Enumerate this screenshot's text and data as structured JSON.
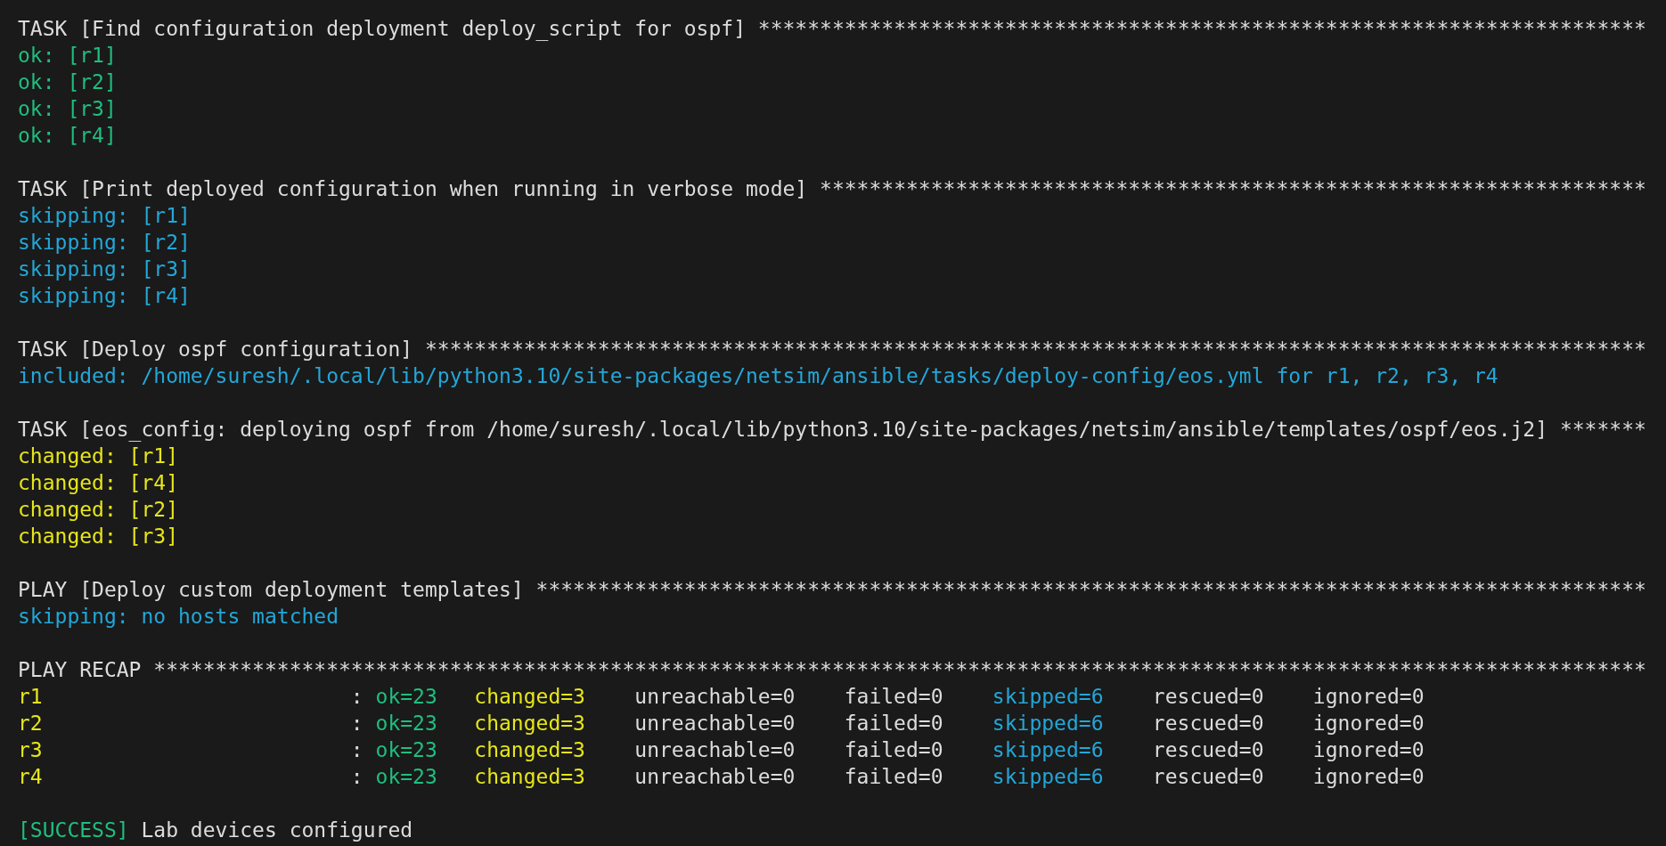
{
  "terminal": {
    "blocks": [
      {
        "header": "TASK [Find configuration deployment deploy_script for ospf] ************************************************************************",
        "lines": [
          {
            "kind": "ok",
            "text": "ok: [r1]"
          },
          {
            "kind": "ok",
            "text": "ok: [r2]"
          },
          {
            "kind": "ok",
            "text": "ok: [r3]"
          },
          {
            "kind": "ok",
            "text": "ok: [r4]"
          }
        ]
      },
      {
        "header": "TASK [Print deployed configuration when running in verbose mode] *******************************************************************",
        "lines": [
          {
            "kind": "skipping",
            "text": "skipping: [r1]"
          },
          {
            "kind": "skipping",
            "text": "skipping: [r2]"
          },
          {
            "kind": "skipping",
            "text": "skipping: [r3]"
          },
          {
            "kind": "skipping",
            "text": "skipping: [r4]"
          }
        ]
      },
      {
        "header": "TASK [Deploy ospf configuration] ***************************************************************************************************",
        "lines": [
          {
            "kind": "skipping",
            "text": "included: /home/suresh/.local/lib/python3.10/site-packages/netsim/ansible/tasks/deploy-config/eos.yml for r1, r2, r3, r4"
          }
        ]
      },
      {
        "header": "TASK [eos_config: deploying ospf from /home/suresh/.local/lib/python3.10/site-packages/netsim/ansible/templates/ospf/eos.j2] *******",
        "lines": [
          {
            "kind": "changed",
            "text": "changed: [r1]"
          },
          {
            "kind": "changed",
            "text": "changed: [r4]"
          },
          {
            "kind": "changed",
            "text": "changed: [r2]"
          },
          {
            "kind": "changed",
            "text": "changed: [r3]"
          }
        ]
      },
      {
        "header": "PLAY [Deploy custom deployment templates] ******************************************************************************************",
        "lines": [
          {
            "kind": "skipping",
            "text": "skipping: no hosts matched"
          }
        ]
      },
      {
        "header": "PLAY RECAP *************************************************************************************************************************",
        "recap": [
          {
            "host": "r1",
            "separator": ":",
            "stats": [
              {
                "kind": "ok",
                "text": "ok=23"
              },
              {
                "kind": "changed",
                "text": "changed=3"
              },
              {
                "kind": "plain",
                "text": "unreachable=0"
              },
              {
                "kind": "plain",
                "text": "failed=0"
              },
              {
                "kind": "skipping",
                "text": "skipped=6"
              },
              {
                "kind": "plain",
                "text": "rescued=0"
              },
              {
                "kind": "plain",
                "text": "ignored=0"
              }
            ]
          },
          {
            "host": "r2",
            "separator": ":",
            "stats": [
              {
                "kind": "ok",
                "text": "ok=23"
              },
              {
                "kind": "changed",
                "text": "changed=3"
              },
              {
                "kind": "plain",
                "text": "unreachable=0"
              },
              {
                "kind": "plain",
                "text": "failed=0"
              },
              {
                "kind": "skipping",
                "text": "skipped=6"
              },
              {
                "kind": "plain",
                "text": "rescued=0"
              },
              {
                "kind": "plain",
                "text": "ignored=0"
              }
            ]
          },
          {
            "host": "r3",
            "separator": ":",
            "stats": [
              {
                "kind": "ok",
                "text": "ok=23"
              },
              {
                "kind": "changed",
                "text": "changed=3"
              },
              {
                "kind": "plain",
                "text": "unreachable=0"
              },
              {
                "kind": "plain",
                "text": "failed=0"
              },
              {
                "kind": "skipping",
                "text": "skipped=6"
              },
              {
                "kind": "plain",
                "text": "rescued=0"
              },
              {
                "kind": "plain",
                "text": "ignored=0"
              }
            ]
          },
          {
            "host": "r4",
            "separator": ":",
            "stats": [
              {
                "kind": "ok",
                "text": "ok=23"
              },
              {
                "kind": "changed",
                "text": "changed=3"
              },
              {
                "kind": "plain",
                "text": "unreachable=0"
              },
              {
                "kind": "plain",
                "text": "failed=0"
              },
              {
                "kind": "skipping",
                "text": "skipped=6"
              },
              {
                "kind": "plain",
                "text": "rescued=0"
              },
              {
                "kind": "plain",
                "text": "ignored=0"
              }
            ]
          }
        ]
      }
    ],
    "footer": {
      "status": "[SUCCESS]",
      "message": "Lab devices configured"
    }
  }
}
